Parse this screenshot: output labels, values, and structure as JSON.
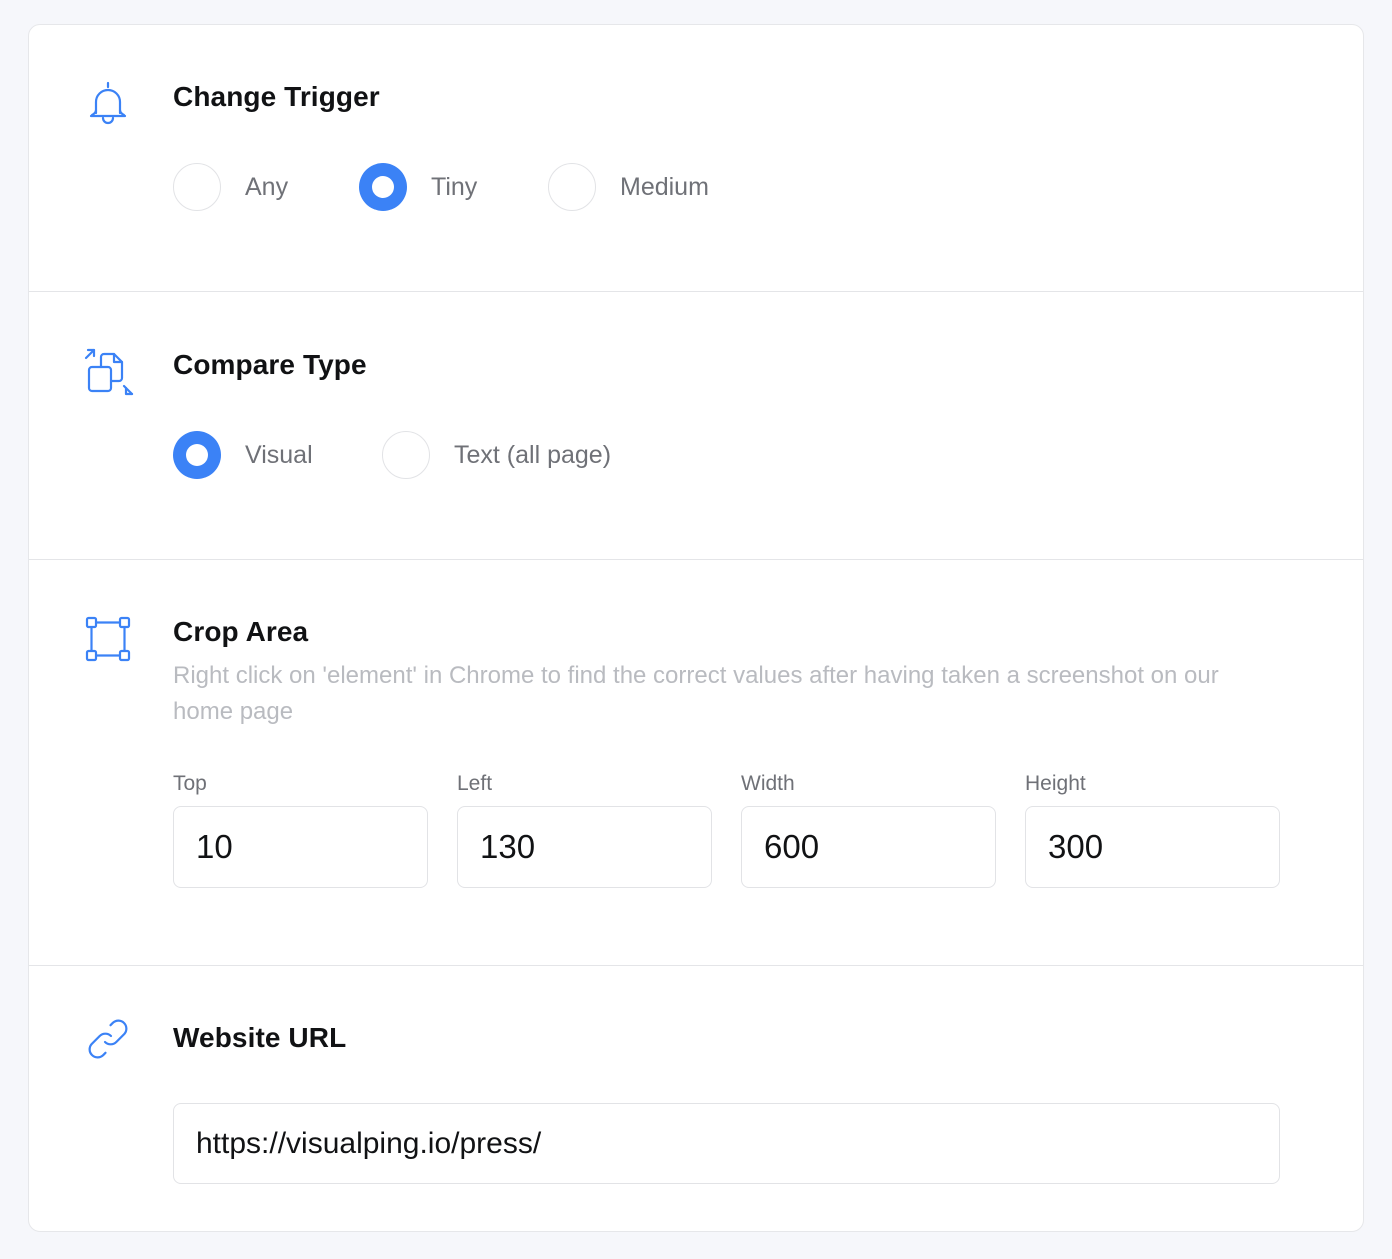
{
  "accent_color": "#3b82f6",
  "change_trigger": {
    "icon": "bell-icon",
    "title": "Change Trigger",
    "options": [
      {
        "label": "Any",
        "checked": false
      },
      {
        "label": "Tiny",
        "checked": true
      },
      {
        "label": "Medium",
        "checked": false
      }
    ]
  },
  "compare_type": {
    "icon": "compare-documents-icon",
    "title": "Compare Type",
    "options": [
      {
        "label": "Visual",
        "checked": true
      },
      {
        "label": "Text (all page)",
        "checked": false
      }
    ]
  },
  "crop_area": {
    "icon": "crop-area-icon",
    "title": "Crop Area",
    "hint": "Right click on 'element' in Chrome to find the correct values after having taken a screenshot on our home page",
    "fields": [
      {
        "label": "Top",
        "value": "10"
      },
      {
        "label": "Left",
        "value": "130"
      },
      {
        "label": "Width",
        "value": "600"
      },
      {
        "label": "Height",
        "value": "300"
      }
    ]
  },
  "website_url": {
    "icon": "link-icon",
    "title": "Website URL",
    "value": "https://visualping.io/press/"
  }
}
